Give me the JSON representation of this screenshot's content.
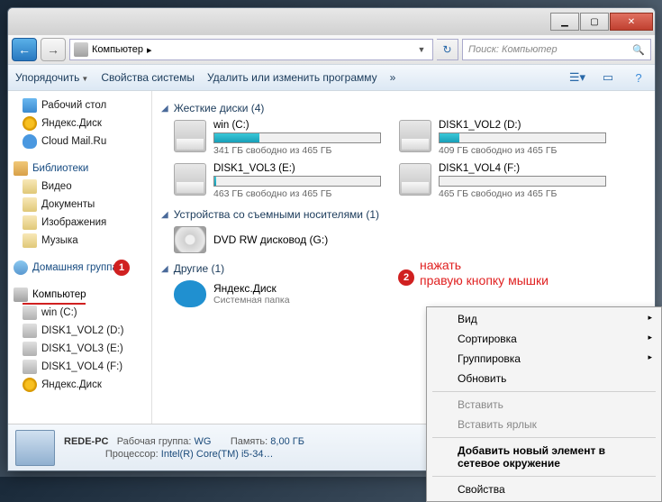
{
  "titlebar": {
    "min": "▁",
    "max": "▢",
    "close": "✕"
  },
  "nav": {
    "back": "←",
    "fwd": "→",
    "addr_label": "Компьютер",
    "sep": "▸",
    "refresh": "↻",
    "search_placeholder": "Поиск: Компьютер",
    "search_icon": "🔍"
  },
  "toolbar": {
    "organize": "Упорядочить",
    "props": "Свойства системы",
    "uninstall": "Удалить или изменить программу",
    "chev": "»",
    "drop": "▼"
  },
  "sidebar": {
    "desktop": "Рабочий стол",
    "ydisk": "Яндекс.Диск",
    "cloud": "Cloud Mail.Ru",
    "libs": "Библиотеки",
    "video": "Видео",
    "docs": "Документы",
    "pics": "Изображения",
    "music": "Музыка",
    "homegroup": "Домашняя группа",
    "computer": "Компьютер",
    "win_c": "win (C:)",
    "d2": "DISK1_VOL2 (D:)",
    "d3": "DISK1_VOL3 (E:)",
    "d4": "DISK1_VOL4 (F:)",
    "ydisk2": "Яндекс.Диск"
  },
  "sections": {
    "hdd": "Жесткие диски (4)",
    "removable": "Устройства со съемными носителями (1)",
    "other": "Другие (1)",
    "tri": "◢"
  },
  "drives": [
    {
      "name": "win (C:)",
      "free": "341 ГБ свободно из 465 ГБ",
      "fill": 27
    },
    {
      "name": "DISK1_VOL2 (D:)",
      "free": "409 ГБ свободно из 465 ГБ",
      "fill": 12
    },
    {
      "name": "DISK1_VOL3 (E:)",
      "free": "463 ГБ свободно из 465 ГБ",
      "fill": 1
    },
    {
      "name": "DISK1_VOL4 (F:)",
      "free": "465 ГБ свободно из 465 ГБ",
      "fill": 0
    }
  ],
  "dvd": {
    "name": "DVD RW дисковод (G:)"
  },
  "other": {
    "name": "Яндекс.Диск",
    "sub": "Системная папка"
  },
  "status": {
    "host": "REDE-PC",
    "wg_label": "Рабочая группа:",
    "wg": "WG",
    "mem_label": "Память:",
    "mem": "8,00 ГБ",
    "cpu_label": "Процессор:",
    "cpu": "Intel(R) Core(TM) i5-34…"
  },
  "anno": {
    "b1": "1",
    "b2": "2",
    "txt1": "нажать",
    "txt2": "правую кнопку мышки"
  },
  "ctx": {
    "view": "Вид",
    "sort": "Сортировка",
    "group": "Группировка",
    "refresh": "Обновить",
    "paste": "Вставить",
    "paste_lnk": "Вставить ярлык",
    "add_net": "Добавить новый элемент в сетевое окружение",
    "props": "Свойства",
    "arr": "▸"
  }
}
